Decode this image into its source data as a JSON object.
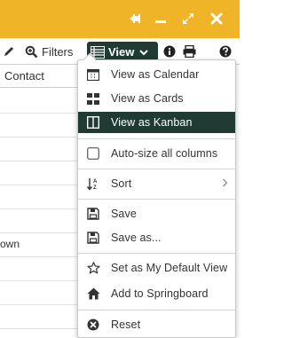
{
  "toolbar": {
    "filters_label": "Filters",
    "view_label": "View"
  },
  "grid": {
    "column_header": "Contact",
    "partial_cell": "own"
  },
  "menu": {
    "items": [
      {
        "label": "View as Calendar",
        "icon": "calendar-icon"
      },
      {
        "label": "View as Cards",
        "icon": "cards-icon"
      },
      {
        "label": "View as Kanban",
        "icon": "kanban-icon",
        "selected": true
      },
      {
        "label": "Auto-size all columns",
        "icon": "checkbox-icon"
      },
      {
        "label": "Sort",
        "icon": "sort-az-icon",
        "has_submenu": true
      },
      {
        "label": "Save",
        "icon": "save-icon"
      },
      {
        "label": "Save as...",
        "icon": "save-as-icon"
      },
      {
        "label": "Set as My Default View",
        "icon": "star-icon"
      },
      {
        "label": "Add to Springboard",
        "icon": "home-icon"
      },
      {
        "label": "Reset",
        "icon": "reset-icon"
      }
    ]
  },
  "colors": {
    "title_bar": "#f0b429",
    "accent_dark": "#1f3b34"
  }
}
